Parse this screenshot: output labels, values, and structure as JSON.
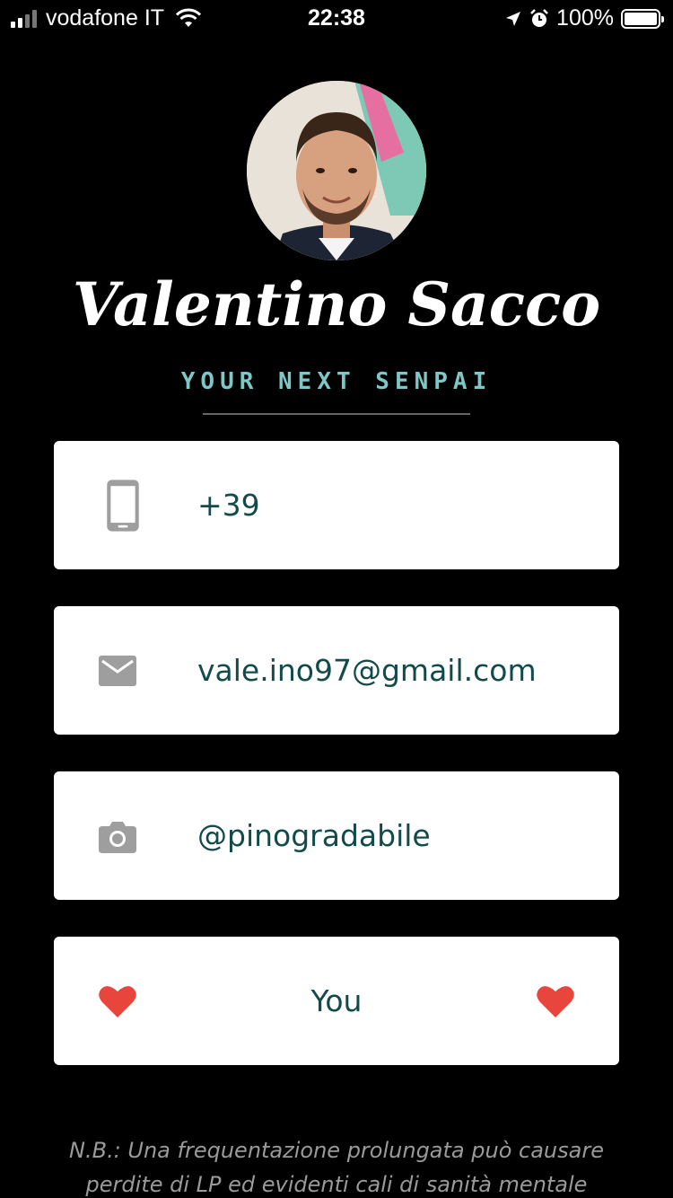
{
  "status_bar": {
    "carrier": "vodafone IT",
    "time": "22:38",
    "battery": "100%"
  },
  "profile": {
    "name": "Valentino Sacco",
    "tagline": "YOUR NEXT SENPAI"
  },
  "contacts": {
    "phone": {
      "icon": "phone-icon",
      "value": "+39"
    },
    "email": {
      "icon": "mail-icon",
      "value": "vale.ino97@gmail.com"
    },
    "instagram": {
      "icon": "camera-icon",
      "value": "@pinogradabile"
    },
    "love": {
      "icon": "heart-icon",
      "value": "You"
    }
  },
  "note": {
    "line1": "N.B.: Una frequentazione prolungata può causare",
    "line2": "perdite di LP ed evidenti cali di sanità mentale"
  },
  "colors": {
    "background": "#000000",
    "accent_teal": "#7fc7c7",
    "card_text": "#134a4a",
    "heart": "#e8453c"
  }
}
